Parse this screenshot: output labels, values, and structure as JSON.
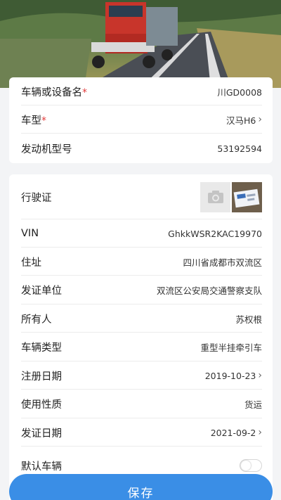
{
  "hero": {
    "image": "logging-truck-on-road-photo"
  },
  "vehicle_card": {
    "name_label": "车辆或设备名",
    "name_required": "*",
    "name_value": "川GD0008",
    "model_label": "车型",
    "model_required": "*",
    "model_value": "汉马H6",
    "engine_label": "发动机型号",
    "engine_value": "53192594"
  },
  "license_card": {
    "license_label": "行驶证",
    "vin_label": "VIN",
    "vin_value": "GhkkWSR2KAC19970",
    "address_label": "住址",
    "address_value": "四川省成都市双流区",
    "issuer_label": "发证单位",
    "issuer_value": "双流区公安局交通警察支队",
    "owner_label": "所有人",
    "owner_value": "苏权根",
    "type_label": "车辆类型",
    "type_value": "重型半挂牵引车",
    "reg_date_label": "注册日期",
    "reg_date_value": "2019-10-23",
    "usage_label": "使用性质",
    "usage_value": "货运",
    "issue_date_label": "发证日期",
    "issue_date_value": "2021-09-2",
    "default_label": "默认车辆",
    "default_on": false
  },
  "icons": {
    "chevron": "›",
    "camera": "camera-icon"
  },
  "save_label": "保存",
  "colors": {
    "primary": "#3a8ee6",
    "required": "#e23b3b"
  }
}
